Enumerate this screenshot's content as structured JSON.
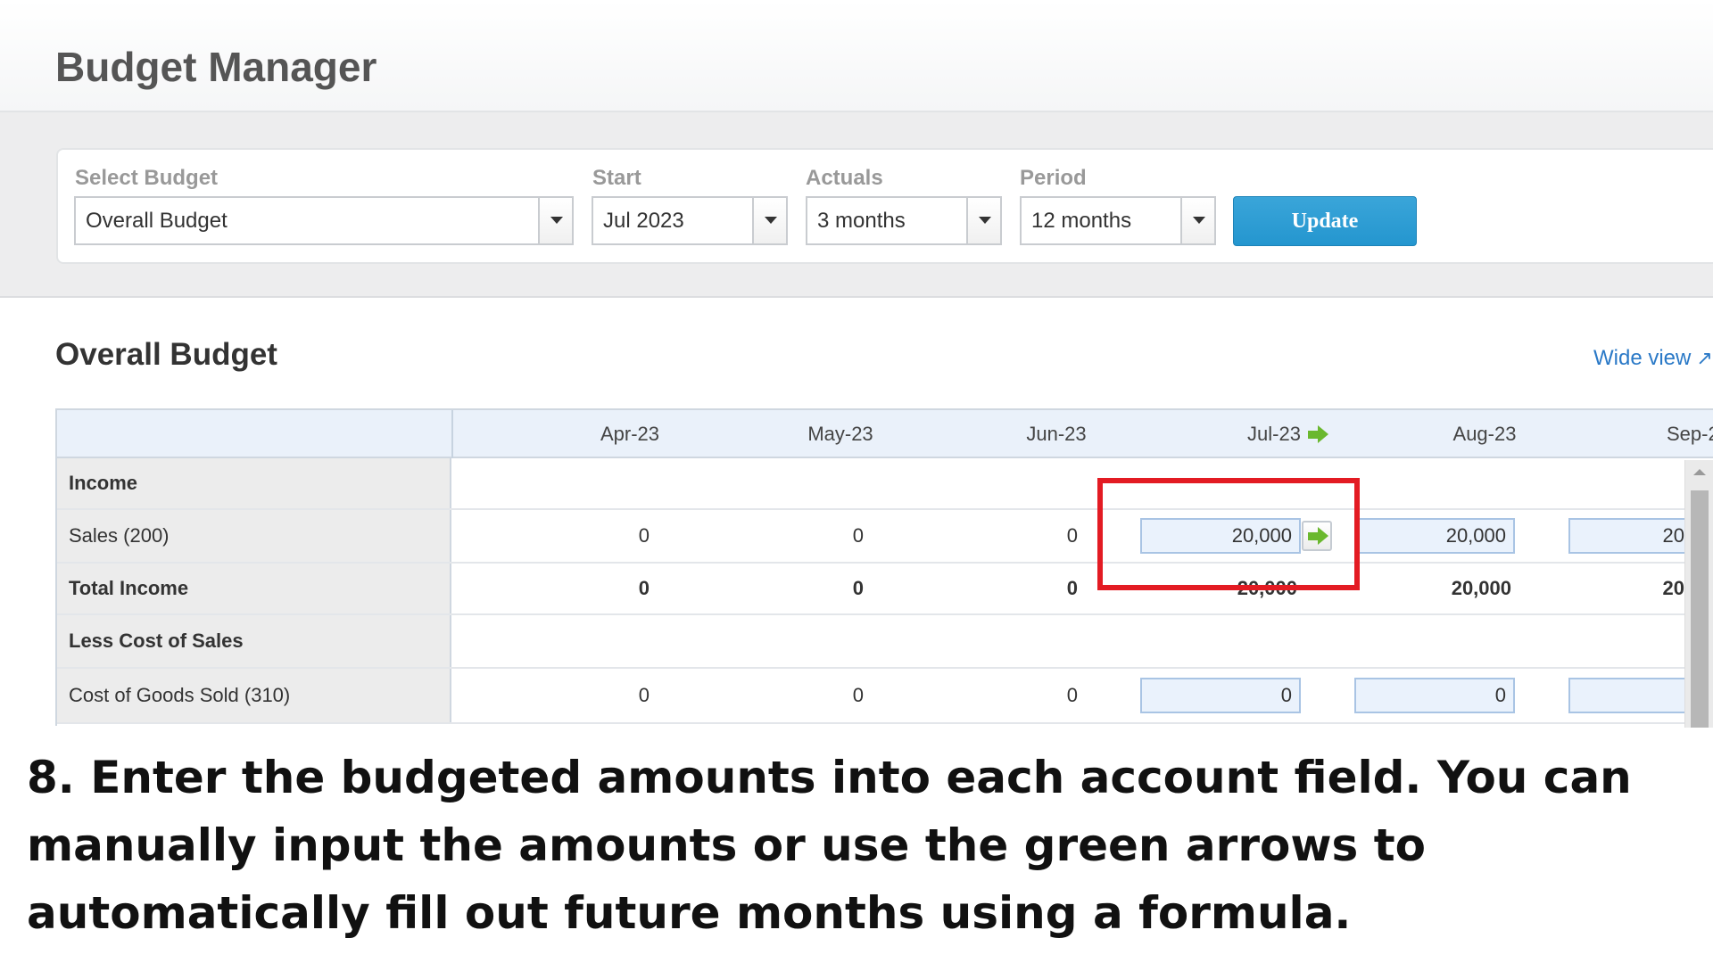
{
  "page_title": "Budget Manager",
  "filters": {
    "select_budget": {
      "label": "Select Budget",
      "value": "Overall Budget"
    },
    "start": {
      "label": "Start",
      "value": "Jul 2023"
    },
    "actuals": {
      "label": "Actuals",
      "value": "3 months"
    },
    "period": {
      "label": "Period",
      "value": "12 months"
    },
    "update_label": "Update"
  },
  "section_title": "Overall Budget",
  "wide_view_label": "Wide view",
  "colors": {
    "accent": "#2496cf",
    "highlight": "#e31b23",
    "arrow": "#6ab82e"
  },
  "table": {
    "columns": [
      "Apr-23",
      "May-23",
      "Jun-23",
      "Jul-23",
      "Aug-23",
      "Sep-2"
    ],
    "rows": {
      "income": {
        "label": "Income"
      },
      "sales": {
        "label": "Sales (200)",
        "values": [
          "0",
          "0",
          "0",
          "20,000",
          "20,000",
          "20"
        ]
      },
      "total_income": {
        "label": "Total Income",
        "values": [
          "0",
          "0",
          "0",
          "20,000",
          "20,000",
          "20"
        ]
      },
      "less_cos": {
        "label": "Less Cost of Sales"
      },
      "cogs": {
        "label": "Cost of Goods Sold (310)",
        "values": [
          "0",
          "0",
          "0",
          "0",
          "0",
          ""
        ]
      }
    }
  },
  "instruction": "8. Enter the budgeted amounts into each account field. You can manually input the amounts or use the green arrows to automatically fill out future months using a formula."
}
